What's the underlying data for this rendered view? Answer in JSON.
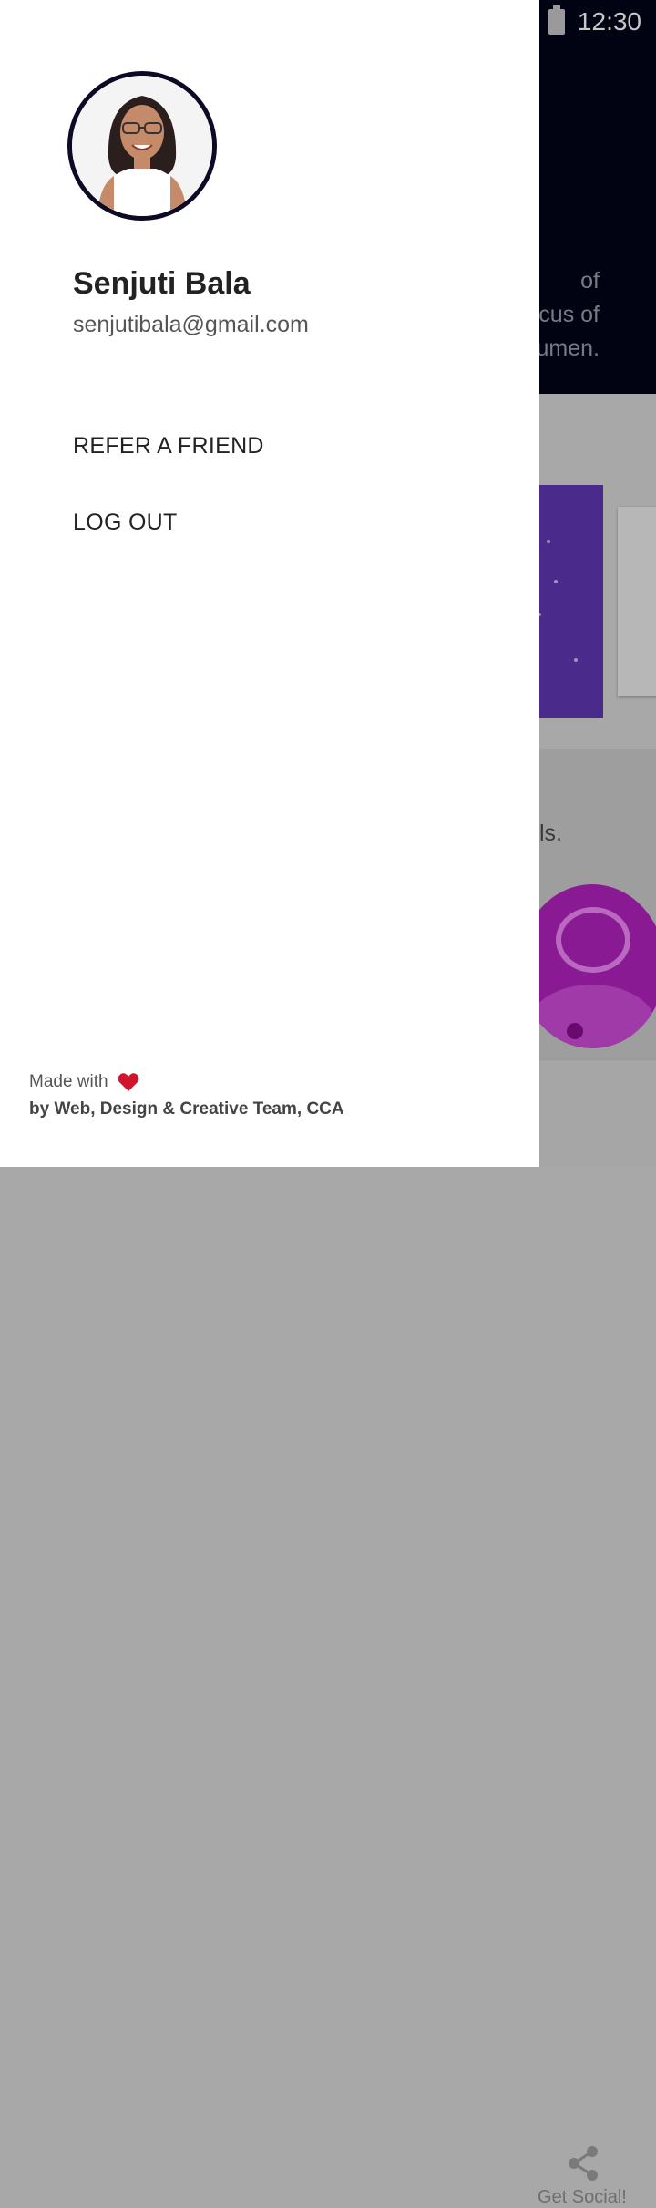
{
  "status_bar": {
    "time": "12:30"
  },
  "background": {
    "header_text": [
      "of",
      "cus of",
      "umen."
    ],
    "lower_text": "cells.",
    "tab_label": "Get Social!"
  },
  "drawer": {
    "user": {
      "name": "Senjuti Bala",
      "email": "senjutibala@gmail.com"
    },
    "menu": [
      {
        "label": "REFER A FRIEND"
      },
      {
        "label": "LOG OUT"
      }
    ],
    "footer": {
      "made_with": "Made with",
      "credit": "by Web, Design & Creative Team, CCA"
    }
  },
  "colors": {
    "accent": "#0c0a24",
    "heart": "#d0142c",
    "overlay": "#a8a8a8"
  }
}
